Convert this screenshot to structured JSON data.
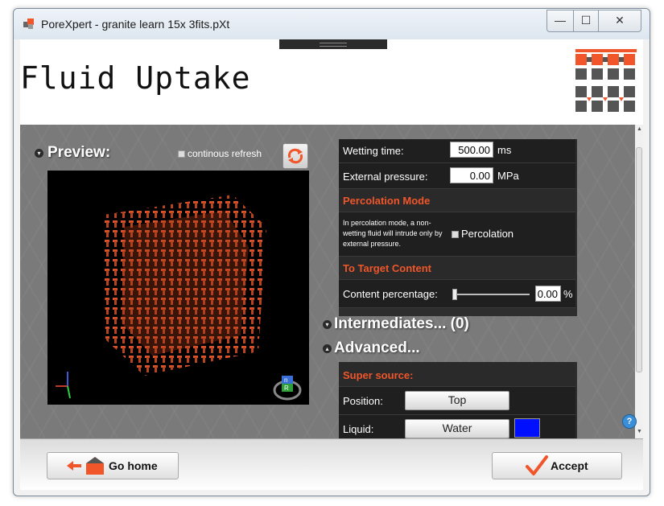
{
  "window": {
    "title": "PoreXpert - granite learn 15x 3fits.pXt",
    "controls": {
      "minimize": "—",
      "maximize": "☐",
      "close": "✕"
    }
  },
  "header": {
    "title": "Fluid Uptake"
  },
  "preview": {
    "title": "Preview:",
    "continuous_refresh_label": "continous refresh",
    "refresh_icon": "refresh-arrows-icon",
    "orientation_cube": {
      "top": "n",
      "front": "R"
    }
  },
  "settings": {
    "wetting_time": {
      "label": "Wetting time:",
      "value": "500.00",
      "unit": "ms"
    },
    "external_pressure": {
      "label": "External pressure:",
      "value": "0.00",
      "unit": "MPa"
    },
    "percolation": {
      "heading": "Percolation Mode",
      "description": "In percolation mode, a non-wetting fluid will intrude only by external pressure.",
      "checkbox_label": "Percolation"
    },
    "target_content": {
      "heading": "To Target Content",
      "label": "Content percentage:",
      "value": "0.00",
      "unit": "%",
      "slider_level": 0
    }
  },
  "intermediates": {
    "title": "Intermediates... (0)"
  },
  "advanced": {
    "title": "Advanced...",
    "super_source": {
      "heading": "Super source:",
      "position_label": "Position:",
      "position_value": "Top",
      "liquid_label": "Liquid:",
      "liquid_value": "Water",
      "liquid_color": "#0010ff"
    }
  },
  "footer": {
    "go_home": "Go home",
    "accept": "Accept"
  },
  "help": "?",
  "colors": {
    "accent": "#f0562a",
    "panel_bg": "#1f1f1f",
    "background": "#7a7a7a"
  }
}
